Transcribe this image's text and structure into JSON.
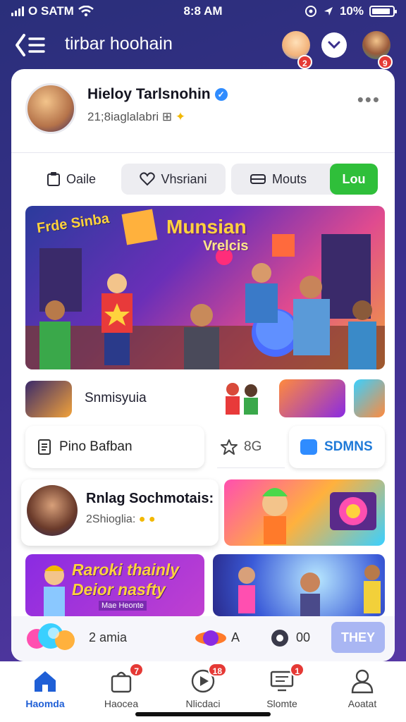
{
  "status_bar": {
    "carrier": "O SATM",
    "time": "8:8 AM",
    "battery": "10%",
    "battery_level": 0.9
  },
  "header": {
    "title": "tirbar hoohain",
    "badge_left": "2",
    "badge_right": "9"
  },
  "profile": {
    "name": "Hieloy Tarlsnohin",
    "subtitle": "21;8iaglalabri"
  },
  "tabs": [
    {
      "label": "Oaile",
      "icon": "clipboard-icon"
    },
    {
      "label": "Vhsriani",
      "icon": "heart-icon"
    },
    {
      "label": "Mouts",
      "icon": "car-icon"
    },
    {
      "label": "Lou",
      "icon": ""
    }
  ],
  "hero": {
    "sign": "Frde Sinba",
    "title": "Munsian",
    "subtitle": "Vrelcis"
  },
  "row_a": {
    "label": "Snmisyuia"
  },
  "row_b": {
    "left_label": "Pino Bafban",
    "star_value": "8G",
    "right_label": "SDMNS"
  },
  "row_c": {
    "title": "Rnlag Sochmotais:",
    "subtitle": "2Shioglia:"
  },
  "promo": {
    "title_line1": "Raroki thainly",
    "title_line2": "Deior nasfty",
    "subtitle": "Mae Heonte"
  },
  "bottom_strip": {
    "left_text": "2 amia",
    "mid_text": "A",
    "right_text": "00",
    "button": "THEY"
  },
  "nav": [
    {
      "label": "Haomda",
      "icon": "home-icon",
      "badge": ""
    },
    {
      "label": "Haocea",
      "icon": "bag-icon",
      "badge": "7"
    },
    {
      "label": "Nlicdaci",
      "icon": "play-icon",
      "badge": "18"
    },
    {
      "label": "Slomte",
      "icon": "monitor-icon",
      "badge": "1"
    },
    {
      "label": "Aoatat",
      "icon": "user-icon",
      "badge": ""
    }
  ],
  "colors": {
    "accent": "#1f5fd6",
    "green": "#2fbf3a",
    "badge": "#e53935"
  }
}
